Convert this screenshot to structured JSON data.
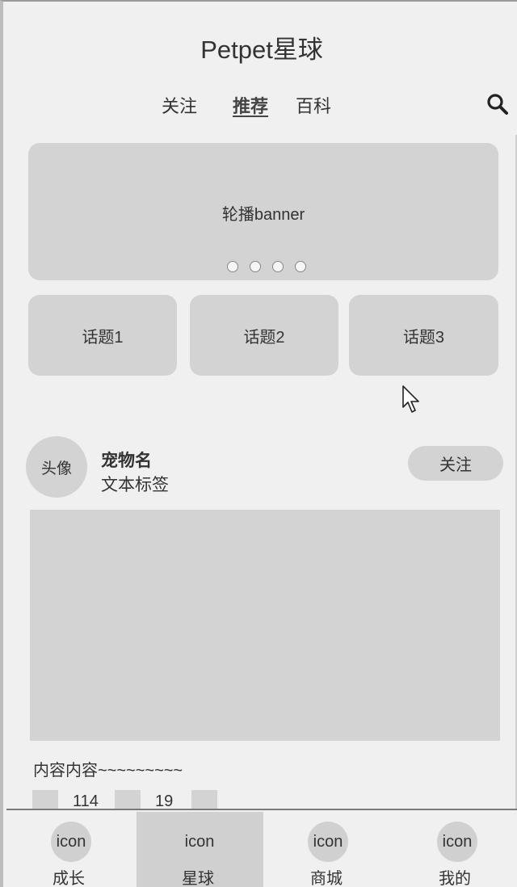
{
  "header": {
    "app_title": "Petpet星球",
    "tabs": [
      {
        "label": "关注"
      },
      {
        "label": "推荐",
        "active": true
      },
      {
        "label": "百科"
      }
    ],
    "search_icon": "search-icon"
  },
  "banner": {
    "label": "轮播banner",
    "dot_count": 4
  },
  "topics": [
    {
      "label": "话题1"
    },
    {
      "label": "话题2"
    },
    {
      "label": "话题3"
    }
  ],
  "post": {
    "avatar_label": "头像",
    "pet_name": "宠物名",
    "tag_text": "文本标签",
    "follow_label": "关注",
    "content_text": "内容内容~~~~~~~~~",
    "stats": [
      {
        "value": "114"
      },
      {
        "value": "19"
      }
    ]
  },
  "tabbar": {
    "items": [
      {
        "icon_text": "icon",
        "label": "成长"
      },
      {
        "icon_text": "icon",
        "label": "星球",
        "active": true
      },
      {
        "icon_text": "icon",
        "label": "商城"
      },
      {
        "icon_text": "icon",
        "label": "我的"
      }
    ]
  },
  "colors": {
    "background": "#f0f0f0",
    "placeholder_gray": "#d3d3d3",
    "text": "#333333"
  }
}
